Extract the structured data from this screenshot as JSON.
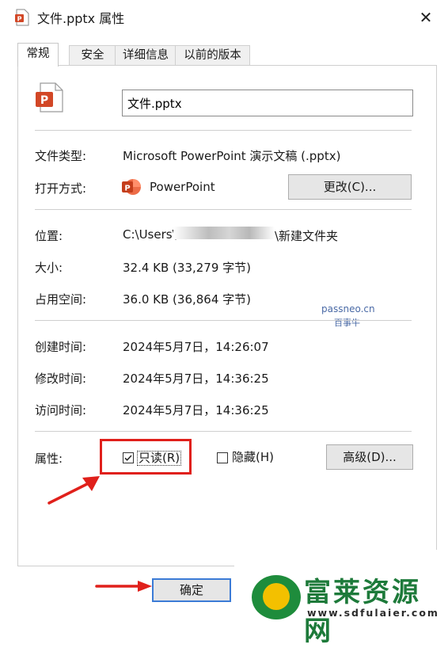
{
  "window": {
    "title": "文件.pptx 属性",
    "close_glyph": "✕"
  },
  "tabs": [
    {
      "label": "常规",
      "active": true
    },
    {
      "label": "安全",
      "active": false
    },
    {
      "label": "详细信息",
      "active": false
    },
    {
      "label": "以前的版本",
      "active": false
    }
  ],
  "file": {
    "name": "文件.pptx"
  },
  "info": {
    "type_label": "文件类型:",
    "type_value": "Microsoft PowerPoint 演示文稿 (.pptx)",
    "opens_label": "打开方式:",
    "opens_app": "PowerPoint",
    "change_button": "更改(C)...",
    "location_label": "位置:",
    "location_prefix": "C:\\Users\\",
    "location_suffix": "\\新建文件夹",
    "size_label": "大小:",
    "size_value": "32.4 KB (33,279 字节)",
    "disk_label": "占用空间:",
    "disk_value": "36.0 KB (36,864 字节)",
    "created_label": "创建时间:",
    "created_value": "2024年5月7日，14:26:07",
    "modified_label": "修改时间:",
    "modified_value": "2024年5月7日，14:36:25",
    "accessed_label": "访问时间:",
    "accessed_value": "2024年5月7日，14:36:25"
  },
  "attributes": {
    "label": "属性:",
    "readonly_label": "只读(R)",
    "readonly_checked": true,
    "hidden_label": "隐藏(H)",
    "hidden_checked": false,
    "advanced_button": "高级(D)..."
  },
  "footer": {
    "ok_button": "确定"
  },
  "watermark": {
    "line1": "passneo.cn",
    "line2": "百事牛"
  },
  "overlay_logo": {
    "name": "富莱资源网",
    "url": "www.sdfulaier.com"
  },
  "colors": {
    "highlight": "#e0201b",
    "ppt_orange": "#d24726",
    "focus_blue": "#3b7bd6"
  }
}
